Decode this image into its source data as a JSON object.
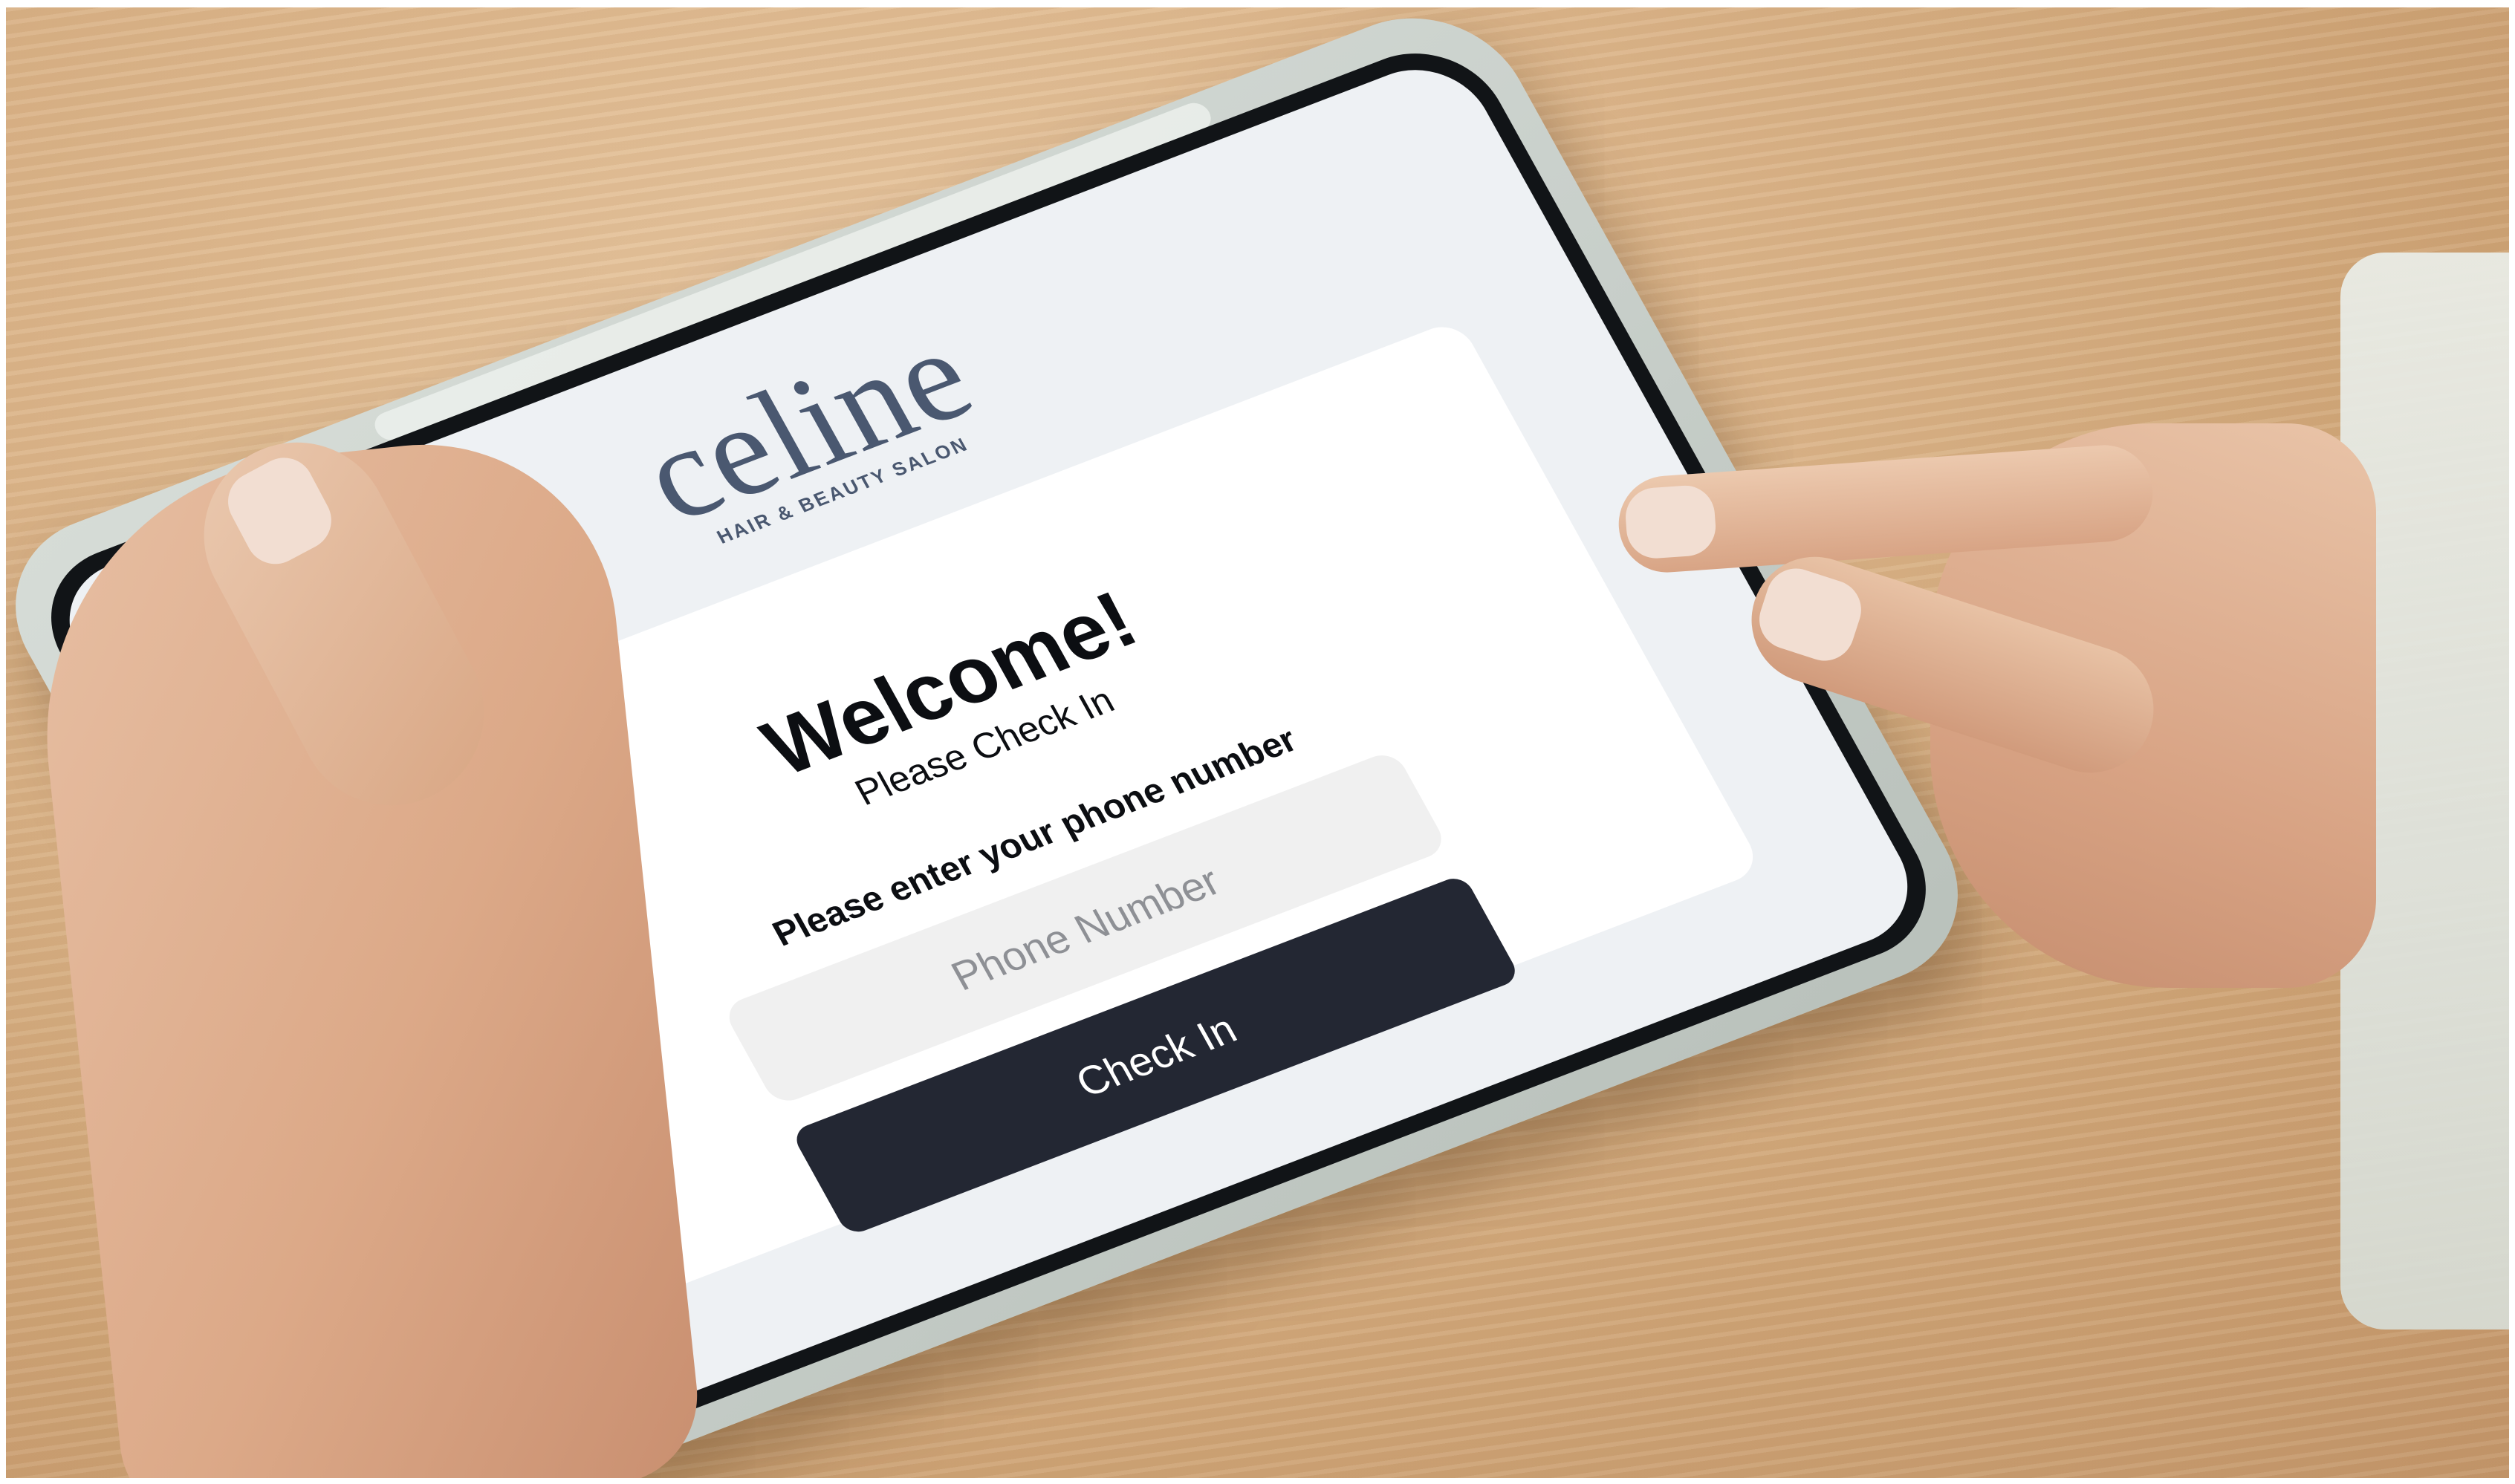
{
  "screen": {
    "logo": {
      "name": "celine",
      "tagline": "HAIR & BEAUTY SALON"
    },
    "welcome_title": "Welcome!",
    "subtitle": "Please Check In",
    "phone_prompt": "Please enter your phone number",
    "phone_input": {
      "value": "",
      "placeholder": "Phone Number"
    },
    "check_in_button": "Check In"
  },
  "colors": {
    "logo": "#4a5870",
    "button_bg": "#232733",
    "button_text": "#ffffff",
    "input_bg": "#f0f0f0",
    "screen_bg": "#eef1f4",
    "card_bg": "#ffffff"
  }
}
